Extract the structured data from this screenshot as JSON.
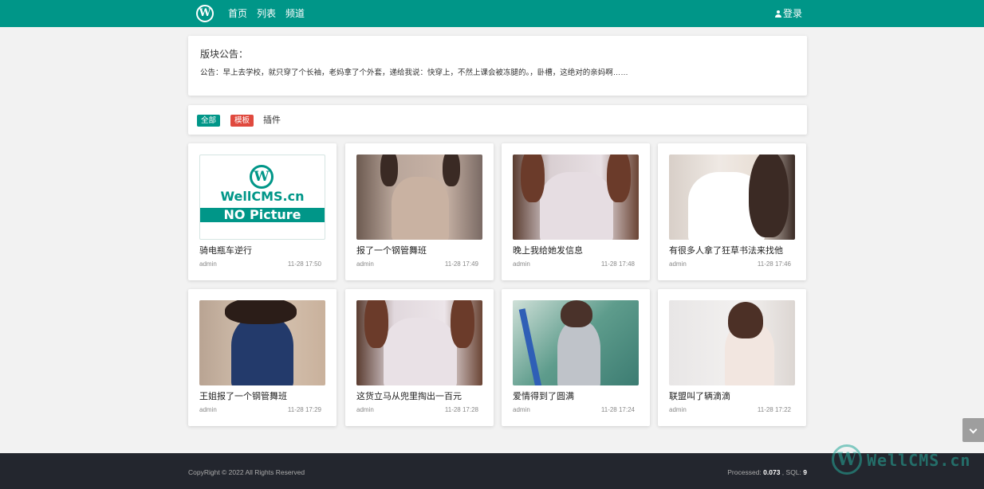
{
  "nav": {
    "logo_letter": "W",
    "links": [
      "首页",
      "列表",
      "频道"
    ],
    "login": "登录",
    "accent": "#009688"
  },
  "notice": {
    "title": "版块公告：",
    "text": "公告：早上去学校，就只穿了个长袖，老妈拿了个外套，递给我说：快穿上，不然上课会被冻腿的。，卧槽，这绝对的亲妈啊……"
  },
  "filters": {
    "all": "全部",
    "template": "模板",
    "plugin": "插件"
  },
  "nopic": {
    "letter": "W",
    "brand": "WellCMS.cn",
    "label": "NO Picture"
  },
  "cards": [
    {
      "title": "骑电瓶车逆行",
      "author": "admin",
      "date": "11-28 17:50",
      "thumb": "nopic"
    },
    {
      "title": "报了一个钢管舞班",
      "author": "admin",
      "date": "11-28 17:49",
      "thumb": "photo"
    },
    {
      "title": "晚上我给她发信息",
      "author": "admin",
      "date": "11-28 17:48",
      "thumb": "photo"
    },
    {
      "title": "有很多人拿了狂草书法来找他",
      "author": "admin",
      "date": "11-28 17:46",
      "thumb": "photo"
    },
    {
      "title": "王姐报了一个钢管舞班",
      "author": "admin",
      "date": "11-28 17:29",
      "thumb": "photo"
    },
    {
      "title": "这货立马从兜里掏出一百元",
      "author": "admin",
      "date": "11-28 17:28",
      "thumb": "photo"
    },
    {
      "title": "爱情得到了圆满",
      "author": "admin",
      "date": "11-28 17:24",
      "thumb": "photo"
    },
    {
      "title": "联盟叫了辆滴滴",
      "author": "admin",
      "date": "11-28 17:22",
      "thumb": "photo"
    }
  ],
  "footer": {
    "copyright": "CopyRight © 2022 All Rights Reserved",
    "processed_label": "Processed: ",
    "processed_value": "0.073",
    "sql_label": " , SQL: ",
    "sql_value": "9"
  },
  "watermark": {
    "letter": "W",
    "text": "WellCMS.cn"
  },
  "icons": {
    "user": "user-icon",
    "scroll": "chevron-down-icon"
  }
}
